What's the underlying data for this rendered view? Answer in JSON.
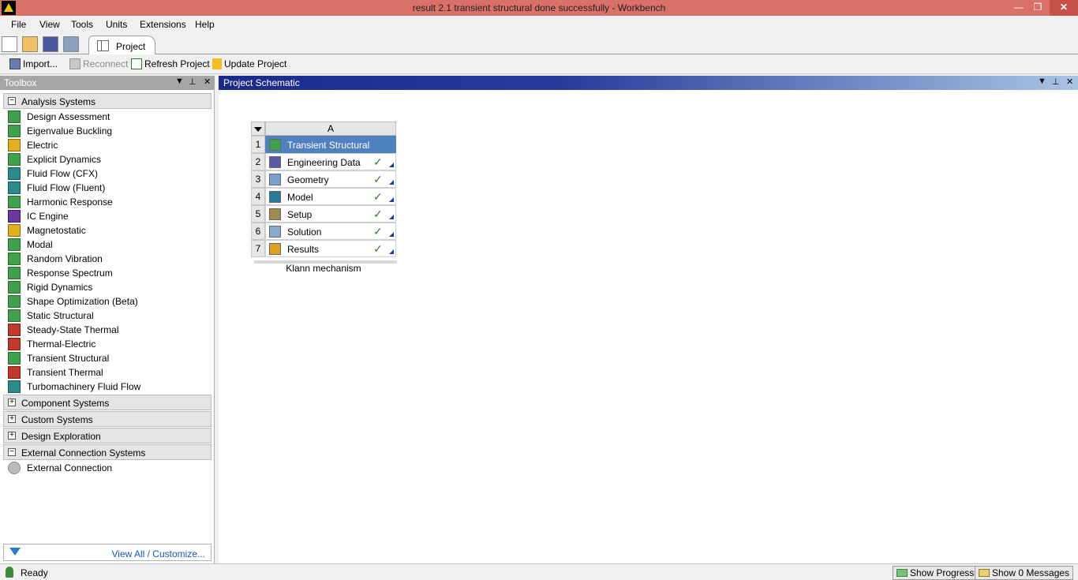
{
  "window": {
    "title": "result 2.1 transient structural done successfully - Workbench",
    "min_glyph": "—",
    "max_glyph": "❐",
    "close_glyph": "✕"
  },
  "menu": [
    "File",
    "View",
    "Tools",
    "Units",
    "Extensions",
    "Help"
  ],
  "tab": {
    "label": "Project"
  },
  "toolbar2": {
    "import": "Import...",
    "reconnect": "Reconnect",
    "refresh": "Refresh Project",
    "update": "Update Project"
  },
  "toolbox": {
    "title": "Toolbox",
    "controls": {
      "dropdown": "▼",
      "pin": "⊥",
      "close": "✕"
    },
    "groups": {
      "analysis": {
        "label": "Analysis Systems",
        "expander": "−"
      },
      "component": {
        "label": "Component Systems",
        "expander": "+"
      },
      "custom": {
        "label": "Custom Systems",
        "expander": "+"
      },
      "exploration": {
        "label": "Design Exploration",
        "expander": "+"
      },
      "external": {
        "label": "External Connection Systems",
        "expander": "−"
      }
    },
    "analysis_items": [
      "Design Assessment",
      "Eigenvalue Buckling",
      "Electric",
      "Explicit Dynamics",
      "Fluid Flow (CFX)",
      "Fluid Flow (Fluent)",
      "Harmonic Response",
      "IC Engine",
      "Magnetostatic",
      "Modal",
      "Random Vibration",
      "Response Spectrum",
      "Rigid Dynamics",
      "Shape Optimization (Beta)",
      "Static Structural",
      "Steady-State Thermal",
      "Thermal-Electric",
      "Transient Structural",
      "Transient Thermal",
      "Turbomachinery Fluid Flow"
    ],
    "external_items": [
      "External Connection"
    ],
    "view_all": "View All / Customize..."
  },
  "schematic": {
    "title": "Project Schematic",
    "controls": {
      "dropdown": "▼",
      "pin": "⊥",
      "close": "✕"
    },
    "system": {
      "column": "A",
      "name": "Klann mechanism",
      "rows": [
        {
          "num": "1",
          "label": "Transient Structural",
          "status": ""
        },
        {
          "num": "2",
          "label": "Engineering Data",
          "status": "✓"
        },
        {
          "num": "3",
          "label": "Geometry",
          "status": "✓"
        },
        {
          "num": "4",
          "label": "Model",
          "status": "✓"
        },
        {
          "num": "5",
          "label": "Setup",
          "status": "✓"
        },
        {
          "num": "6",
          "label": "Solution",
          "status": "✓"
        },
        {
          "num": "7",
          "label": "Results",
          "status": "✓"
        }
      ]
    }
  },
  "status": {
    "text": "Ready",
    "show_progress": "Show Progress",
    "show_messages": "Show 0 Messages"
  }
}
